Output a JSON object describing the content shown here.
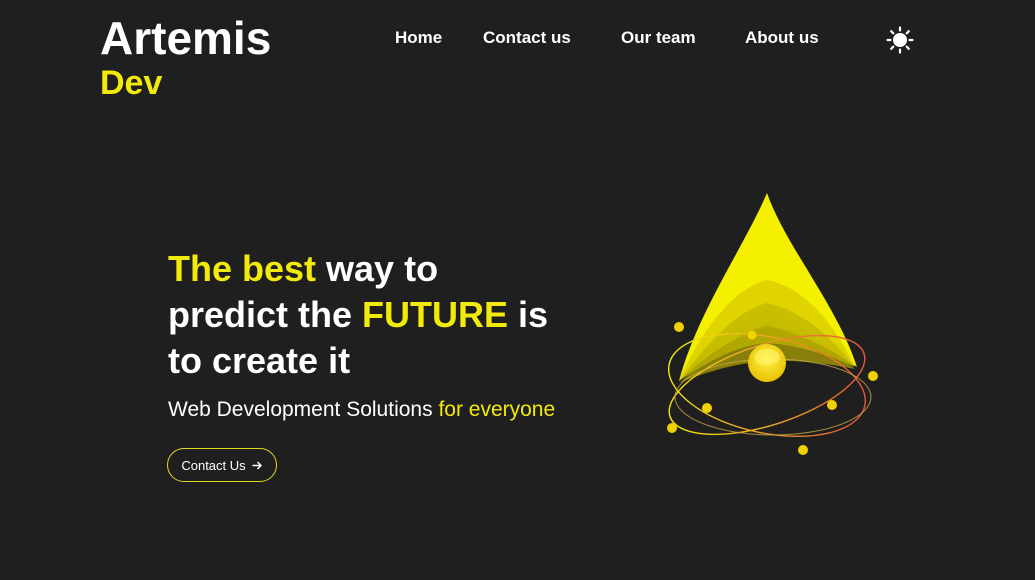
{
  "brand": {
    "name": "Artemis",
    "suffix": "Dev"
  },
  "nav": {
    "items": [
      {
        "label": "Home"
      },
      {
        "label": "Contact us"
      },
      {
        "label": "Our team"
      },
      {
        "label": "About us"
      }
    ],
    "theme_icon": "sun-icon"
  },
  "hero": {
    "headline": {
      "p1": "The best",
      "p2": " way to",
      "p3": "predict the ",
      "p4": "FUTURE",
      "p5": " is",
      "p6": "to create it"
    },
    "subtitle": {
      "main": "Web Development Solutions ",
      "accent": "for everyone"
    },
    "cta": {
      "label": "Contact Us",
      "icon": "arrow-right-icon"
    }
  },
  "illustration": {
    "icon": "rocket-atom-icon"
  },
  "colors": {
    "accent": "#f2ea0a",
    "background": "#1f1f1f",
    "text": "#ffffff"
  }
}
